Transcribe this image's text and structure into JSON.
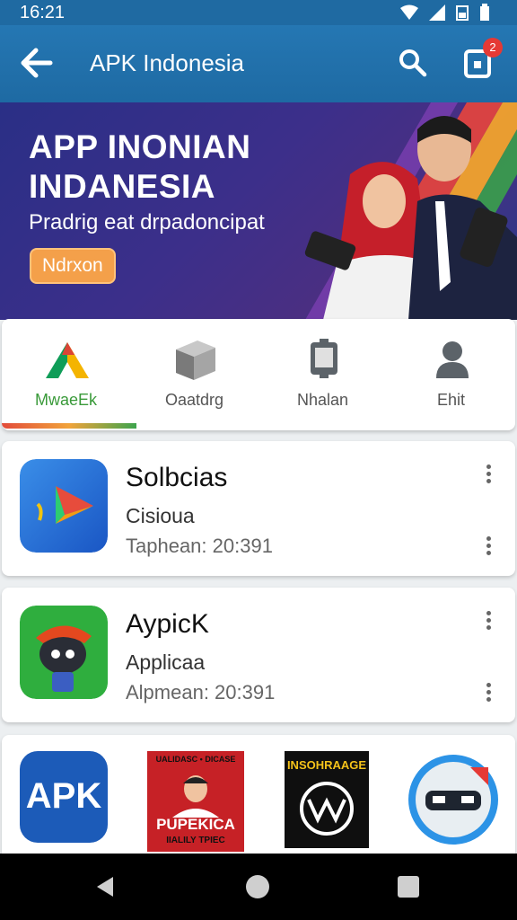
{
  "status": {
    "time": "16:21"
  },
  "appbar": {
    "title": "APK Indonesia",
    "notification_count": "2"
  },
  "banner": {
    "title": "APP INONIAN\nINDANESIA",
    "subtitle": "Pradrig eat drpadoncipat",
    "cta": "Ndrxon"
  },
  "categories": [
    {
      "label": "MwaeEk",
      "icon": "triangle-logo-icon",
      "active": true
    },
    {
      "label": "Oaatdrg",
      "icon": "box-icon",
      "active": false
    },
    {
      "label": "Nhalan",
      "icon": "device-icon",
      "active": false
    },
    {
      "label": "Ehit",
      "icon": "person-icon",
      "active": false
    }
  ],
  "apps": [
    {
      "name": "Solbcias",
      "category": "Cisioua",
      "meta": "Taphean: 20:391",
      "icon": "play-arrow-icon"
    },
    {
      "name": "AypicK",
      "category": "Applicaa",
      "meta": "Alpmean: 20:391",
      "icon": "mascot-icon"
    }
  ],
  "tiles": {
    "apk_logo": "APK",
    "poster_top": "UALIDASC • DICASE",
    "poster_title": "PUPEKICA",
    "poster_sub": "IIALILY TPIEC",
    "dark_title": "INSOHRAAGE"
  },
  "colors": {
    "appbar": "#1f6aa2",
    "badge": "#e53935",
    "cta": "#f4a04a",
    "active_tab": "#3a9a3a"
  }
}
